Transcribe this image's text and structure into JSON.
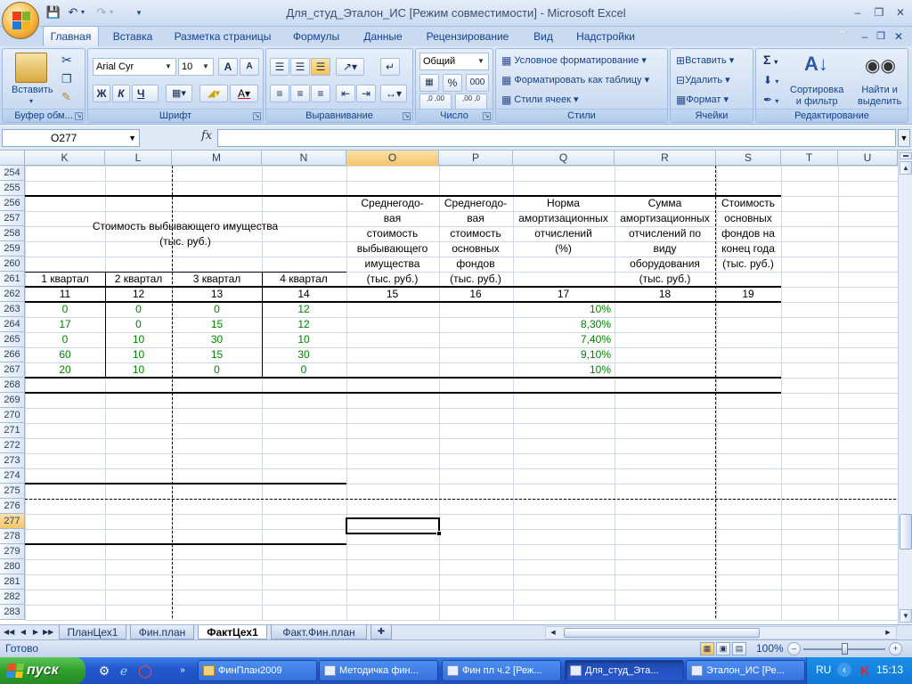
{
  "window": {
    "title": "Для_студ_Эталон_ИС  [Режим совместимости] - Microsoft Excel",
    "minimize": "–",
    "maximize": "❒",
    "close": "✕"
  },
  "ribbon_tabs": [
    "Главная",
    "Вставка",
    "Разметка страницы",
    "Формулы",
    "Данные",
    "Рецензирование",
    "Вид",
    "Надстройки"
  ],
  "ribbon": {
    "clipboard": {
      "label": "Буфер обм...",
      "paste": "Вставить"
    },
    "font": {
      "label": "Шрифт",
      "name": "Arial Cyr",
      "size": "10",
      "bold": "Ж",
      "italic": "К",
      "underline": "Ч",
      "grow": "A",
      "shrink": "A"
    },
    "alignment": {
      "label": "Выравнивание"
    },
    "number": {
      "label": "Число",
      "format": "Общий",
      "percent": "%",
      "thousands": "000",
      "inc": ",0 ,00",
      "dec": ",00 ,0"
    },
    "styles": {
      "label": "Стили",
      "conditional": "Условное форматирование",
      "table": "Форматировать как таблицу",
      "cell_styles": "Стили ячеек"
    },
    "cells": {
      "label": "Ячейки",
      "insert": "Вставить",
      "delete": "Удалить",
      "format": "Формат"
    },
    "editing": {
      "label": "Редактирование",
      "sum": "Σ",
      "sort": "Сортировка\nи фильтр",
      "find": "Найти и\nвыделить"
    }
  },
  "formula_bar": {
    "name_box": "O277",
    "fx": "fx",
    "value": ""
  },
  "columns": [
    "K",
    "L",
    "M",
    "N",
    "O",
    "P",
    "Q",
    "R",
    "S",
    "T",
    "U"
  ],
  "selected_column": "O",
  "rows": [
    254,
    255,
    256,
    257,
    258,
    259,
    260,
    261,
    262,
    263,
    264,
    265,
    266,
    267,
    268,
    269,
    270,
    271,
    272,
    273,
    274,
    275,
    276,
    277,
    278,
    279,
    280,
    281,
    282,
    283
  ],
  "selected_row": 277,
  "table": {
    "group_header": "Стоимость выбывающего имущества\n(тыс. руб.)",
    "quarters": [
      "1 квартал",
      "2 квартал",
      "3 квартал",
      "4 квартал"
    ],
    "col_O": "Среднегодо-\nвая\nстоимость\nвыбывающего\nимущества\n(тыс. руб.)",
    "col_P": "Среднегодо-\nвая\nстоимость\nосновных\nфондов\n(тыс. руб.)",
    "col_Q": "Норма\nамортизационных\nотчислений\n(%)",
    "col_R": "Сумма\nамортизационных\nотчислений по\nвиду\nоборудования\n(тыс. руб.)",
    "col_S": "Стоимость\nосновных\nфондов на\nконец года\n(тыс. руб.)",
    "numbers_row": [
      "11",
      "12",
      "13",
      "14",
      "15",
      "16",
      "17",
      "18",
      "19"
    ],
    "data": [
      {
        "k": "0",
        "l": "0",
        "m": "0",
        "n": "12",
        "q": "10%"
      },
      {
        "k": "17",
        "l": "0",
        "m": "15",
        "n": "12",
        "q": "8,30%"
      },
      {
        "k": "0",
        "l": "10",
        "m": "30",
        "n": "10",
        "q": "7,40%"
      },
      {
        "k": "60",
        "l": "10",
        "m": "15",
        "n": "30",
        "q": "9,10%"
      },
      {
        "k": "20",
        "l": "10",
        "m": "0",
        "n": "0",
        "q": "10%"
      }
    ]
  },
  "sheets": [
    "ПланЦех1",
    "Фин.план",
    "ФактЦех1",
    "Факт.Фин.план"
  ],
  "active_sheet": "ФактЦех1",
  "status": {
    "ready": "Готово",
    "zoom": "100%"
  },
  "taskbar": {
    "start": "пуск",
    "tasks": [
      "ФинПлан2009",
      "Методичка фин...",
      "Фин пл ч.2 [Реж...",
      "Для_студ_Эта...",
      "Эталон_ИС [Ре..."
    ],
    "active_task_index": 3,
    "lang": "RU",
    "clock": "15:13"
  }
}
